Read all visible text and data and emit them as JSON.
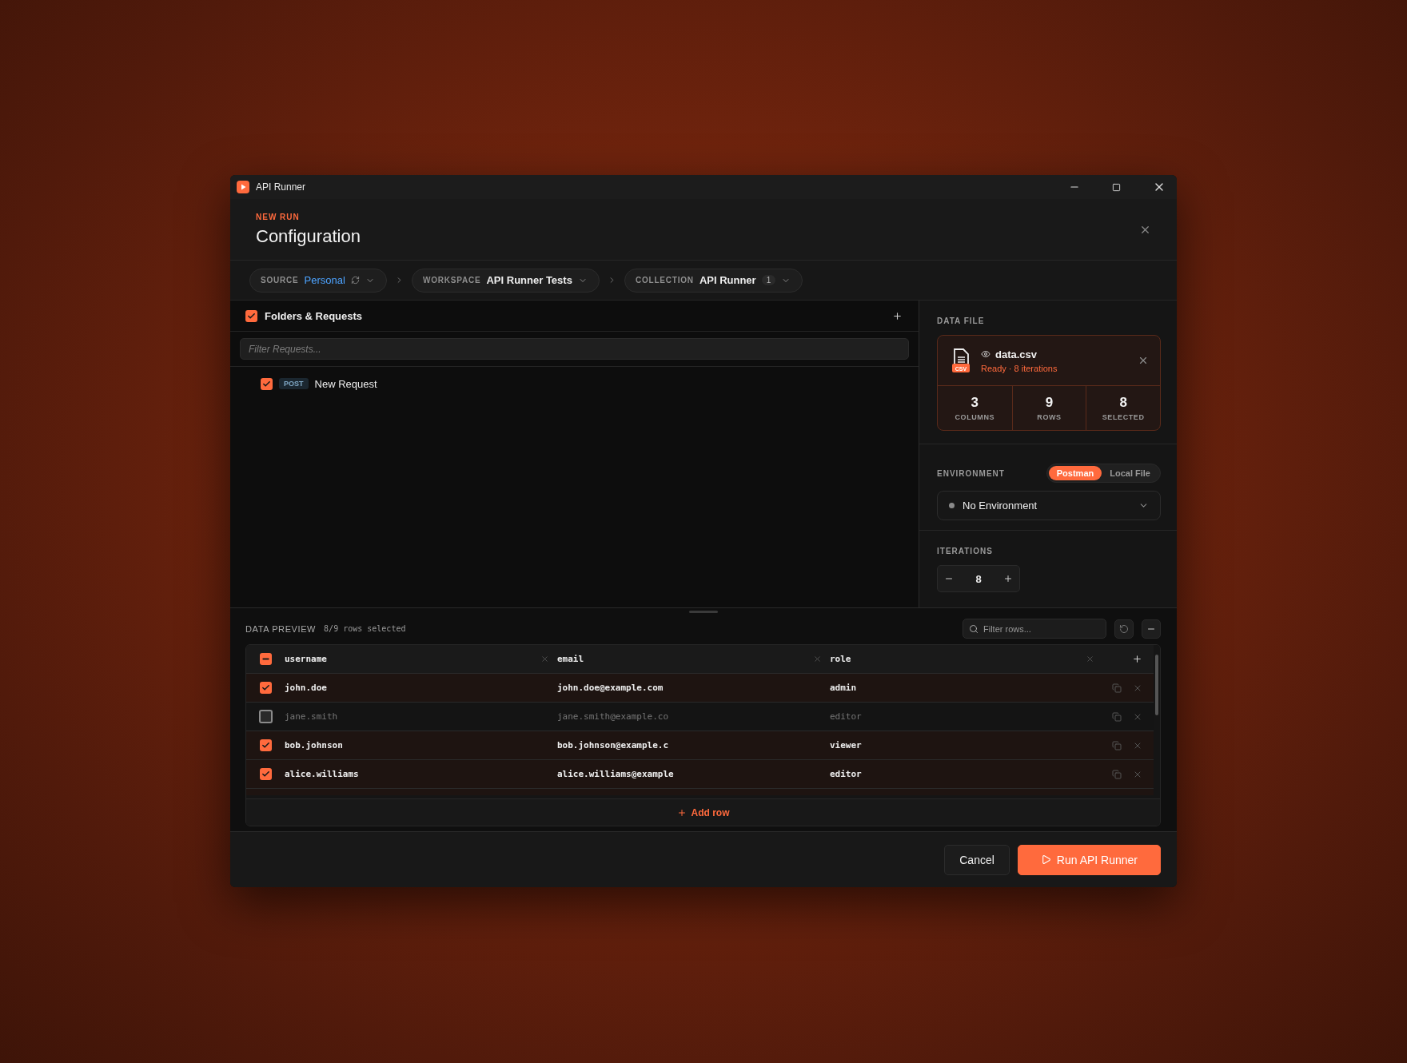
{
  "window": {
    "title": "API Runner"
  },
  "header": {
    "eyebrow": "NEW RUN",
    "title": "Configuration"
  },
  "breadcrumbs": [
    {
      "kind": "source",
      "label": "SOURCE",
      "value": "Personal"
    },
    {
      "kind": "plain",
      "label": "WORKSPACE",
      "value": "API Runner Tests"
    },
    {
      "kind": "count",
      "label": "COLLECTION",
      "value": "API Runner",
      "badge": "1"
    }
  ],
  "requests_panel": {
    "title": "Folders & Requests",
    "checked": true,
    "filter": {
      "placeholder": "Filter Requests..."
    },
    "items": [
      {
        "method": "POST",
        "name": "New Request",
        "checked": true
      }
    ]
  },
  "data_file": {
    "label": "DATA FILE",
    "name": "data.csv",
    "file_type": "CSV",
    "status": "Ready · 8 iterations",
    "stats": [
      {
        "value": "3",
        "label": "COLUMNS"
      },
      {
        "value": "9",
        "label": "ROWS"
      },
      {
        "value": "8",
        "label": "SELECTED"
      }
    ]
  },
  "environment": {
    "label": "ENVIRONMENT",
    "sources": [
      {
        "label": "Postman",
        "selected": true
      },
      {
        "label": "Local File",
        "selected": false
      }
    ],
    "value": "No Environment"
  },
  "iterations": {
    "label": "ITERATIONS",
    "value": "8"
  },
  "data_preview": {
    "title": "DATA PREVIEW",
    "summary": "8/9 rows selected",
    "filter": {
      "placeholder": "Filter rows..."
    },
    "header_checkbox": {
      "checked": true,
      "indeterminate": true
    },
    "columns": [
      "username",
      "email",
      "role"
    ],
    "rows": [
      {
        "checked": true,
        "cells": [
          "john.doe",
          "john.doe@example.com",
          "admin"
        ]
      },
      {
        "checked": false,
        "cells": [
          "jane.smith",
          "jane.smith@example.co",
          "editor"
        ]
      },
      {
        "checked": true,
        "cells": [
          "bob.johnson",
          "bob.johnson@example.c",
          "viewer"
        ]
      },
      {
        "checked": true,
        "cells": [
          "alice.williams",
          "alice.williams@example",
          "editor"
        ]
      }
    ],
    "add_row": "Add row"
  },
  "footer": {
    "buttons": [
      {
        "kind": "secondary",
        "label": "Cancel"
      },
      {
        "kind": "primary",
        "label": "Run API Runner"
      }
    ]
  }
}
